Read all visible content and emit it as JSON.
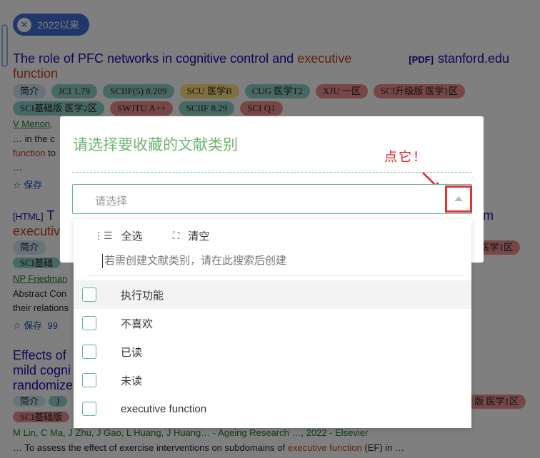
{
  "filter_chip": {
    "label": "2022以来"
  },
  "results": [
    {
      "title_parts": [
        "The role of PFC networks in cognitive control and ",
        "executive",
        "function"
      ],
      "source_format": "[PDF]",
      "source": "stanford.edu",
      "tags_row1": [
        "简介",
        "JCI 1.79",
        "SCIIF(5) 8.209",
        "SCU 医学B",
        "CUG 医学T2",
        "XJU 一区",
        "SCI升级版 医学1区"
      ],
      "tags_row2": [
        "SCI基础版 医学2区",
        "SWJTU A++",
        "SCIIF 8.29",
        "SCI Q1"
      ],
      "authors": "V Menon,",
      "snippet_a": "… in the c",
      "snippet_b": "function",
      "snippet_b2": "to",
      "snippet_c": "…",
      "save": "☆ 保存"
    },
    {
      "source_format": "[HTML]",
      "title_start": "T",
      "title_line2": "executiv",
      "title_end": "m",
      "tag1": "简介",
      "tag_end": "医学1区",
      "tag2": "SCI基础",
      "authors": "NP Friedman",
      "snippet_a": "Abstract Con",
      "snippet_b": "their relations",
      "save": "☆ 保存",
      "extra": "99"
    },
    {
      "title_line1": "Effects of",
      "title_line2": "mild cogni",
      "title_line3": "randomize",
      "tag1": "简介",
      "tag_j": "J",
      "tag_end": "版 医学1区",
      "tag2": "SCI基础版",
      "authors": "M Lin, C Ma, J Zhu, J Gao, L Huang, J Huang… - Ageing Research …, 2022 - Elsevier",
      "snippet_pre": "… To assess the effect of exercise interventions on subdomains of ",
      "snippet_hl": "executive function",
      "snippet_post": " (EF) in …"
    }
  ],
  "dialog": {
    "title": "请选择要收藏的文献类别",
    "select_placeholder": "请选择",
    "hint": "点它！"
  },
  "dropdown": {
    "select_all": "全选",
    "clear": "清空",
    "search_placeholder": "若需创建文献类别，请在此搜索后创建",
    "options": [
      "执行功能",
      "不喜欢",
      "已读",
      "未读",
      "executive function"
    ]
  },
  "colors": {
    "accent": "#5fb59e",
    "title_green": "#6fb56f",
    "hint_red": "#e02222",
    "link_blue": "#1a0dab"
  }
}
